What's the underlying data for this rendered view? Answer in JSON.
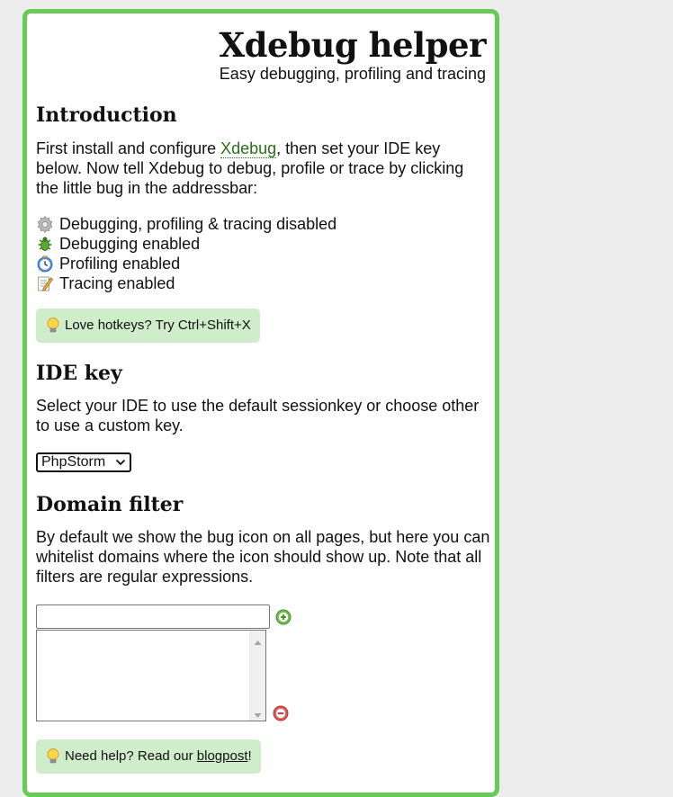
{
  "header": {
    "title": "Xdebug helper",
    "subtitle": "Easy debugging, profiling and tracing"
  },
  "introduction": {
    "heading": "Introduction",
    "text_before_link": "First install and configure ",
    "link_text": "Xdebug",
    "text_after_link": ", then set your IDE key below. Now tell Xdebug to debug, profile or trace by clicking the little bug in the addressbar:",
    "statuses": [
      {
        "icon": "gear-disabled-icon",
        "label": "Debugging, profiling & tracing disabled"
      },
      {
        "icon": "bug-icon",
        "label": "Debugging enabled"
      },
      {
        "icon": "clock-icon",
        "label": "Profiling enabled"
      },
      {
        "icon": "pencil-note-icon",
        "label": "Tracing enabled"
      }
    ],
    "hotkey_tip": "Love hotkeys? Try Ctrl+Shift+X"
  },
  "ide_key": {
    "heading": "IDE key",
    "description": "Select your IDE to use the default sessionkey or choose other to use a custom key.",
    "selected": "PhpStorm"
  },
  "domain_filter": {
    "heading": "Domain filter",
    "description": "By default we show the bug icon on all pages, but here you can whitelist domains where the icon should show up. Note that all filters are regular expressions.",
    "input_value": ""
  },
  "help_tip": {
    "text_before": "Need help? Read our ",
    "link_text": "blogpost",
    "text_after": "!"
  },
  "colors": {
    "panel_border": "#66cc55",
    "tip_background": "#cfeccb",
    "link": "#2a6e1a",
    "add_button": "#6dbf4b",
    "remove_button": "#e05a5a"
  }
}
